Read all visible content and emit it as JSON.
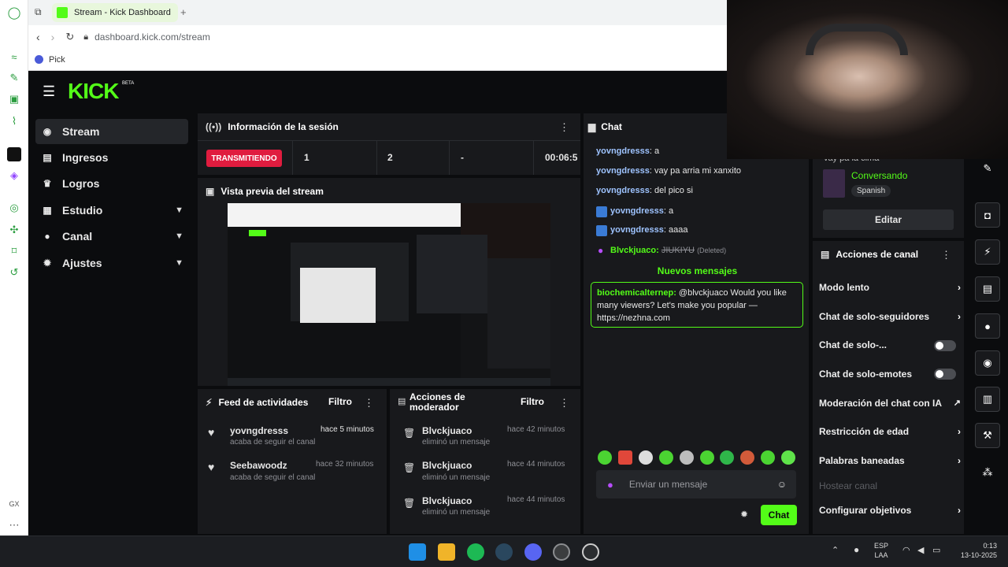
{
  "browser": {
    "tab_title": "Stream - Kick Dashboard",
    "url": "dashboard.kick.com/stream",
    "bookmark": "Pick"
  },
  "brand": {
    "logo": "KICK",
    "beta": "BETA",
    "accent": "#53fc18"
  },
  "nav": {
    "items": [
      {
        "label": "Stream",
        "icon": "broadcast-icon"
      },
      {
        "label": "Ingresos",
        "icon": "chart-icon"
      },
      {
        "label": "Logros",
        "icon": "trophy-icon"
      },
      {
        "label": "Estudio",
        "icon": "grid-icon"
      },
      {
        "label": "Canal",
        "icon": "user-icon"
      },
      {
        "label": "Ajustes",
        "icon": "gear-icon"
      }
    ]
  },
  "session": {
    "title": "Información de la sesión",
    "status": "TRANSMITIENDO",
    "stats": [
      "1",
      "2",
      "-",
      "00:06:5"
    ]
  },
  "preview": {
    "title": "Vista previa del stream"
  },
  "feed": {
    "title": "Feed de actividades",
    "filter": "Filtro",
    "items": [
      {
        "user": "yovngdresss",
        "time": "hace 5 minutos",
        "desc": "acaba de seguir el canal"
      },
      {
        "user": "Seebawoodz",
        "time": "hace 32 minutos",
        "desc": "acaba de seguir el canal"
      }
    ]
  },
  "mod": {
    "title": "Acciones de moderador",
    "filter": "Filtro",
    "items": [
      {
        "user": "Blvckjuaco",
        "time": "hace 42 minutos",
        "desc": "eliminó un mensaje"
      },
      {
        "user": "Blvckjuaco",
        "time": "hace 44 minutos",
        "desc": "eliminó un mensaje"
      },
      {
        "user": "Blvckjuaco",
        "time": "hace 44 minutos",
        "desc": "eliminó un mensaje"
      }
    ]
  },
  "chat": {
    "title": "Chat",
    "messages": [
      {
        "user": "yovngdresss",
        "text": ": a"
      },
      {
        "user": "yovngdresss",
        "text": ": vay pa arria mi xanxito"
      },
      {
        "user": "yovngdresss",
        "text": ": del pico si"
      },
      {
        "user": "yovngdresss",
        "text": ": a"
      },
      {
        "user": "yovngdresss",
        "text": ": aaaa"
      }
    ],
    "deleted": {
      "user": "Blvckjuaco:",
      "text": "JIUKIYU",
      "tag": "(Deleted)"
    },
    "new_label": "Nuevos mensajes",
    "highlight": {
      "user": "biochemicalternep:",
      "text": " @blvckjuaco Would you like many viewers? Let's make you popular — https://nezhna.com"
    },
    "input_placeholder": "Enviar un mensaje",
    "send_label": "Chat"
  },
  "stream_info": {
    "title_partial": "vay pa la cima",
    "category": "Conversando",
    "language": "Spanish",
    "edit_label": "Editar"
  },
  "channel_actions": {
    "title": "Acciones de canal",
    "items": [
      {
        "label": "Modo lento",
        "control": "arrow"
      },
      {
        "label": "Chat de solo-seguidores",
        "control": "arrow"
      },
      {
        "label": "Chat de solo-...",
        "control": "toggle"
      },
      {
        "label": "Chat de solo-emotes",
        "control": "toggle"
      },
      {
        "label": "Moderación del chat con IA",
        "control": "external"
      },
      {
        "label": "Restricción de edad",
        "control": "arrow"
      },
      {
        "label": "Palabras baneadas",
        "control": "arrow"
      },
      {
        "label": "Hostear canal",
        "control": "disabled"
      },
      {
        "label": "Configurar objetivos",
        "control": "arrow"
      }
    ]
  },
  "taskbar": {
    "lang": "ESP",
    "layout": "LAA",
    "time": "0:13",
    "date": "13-10-2025"
  }
}
